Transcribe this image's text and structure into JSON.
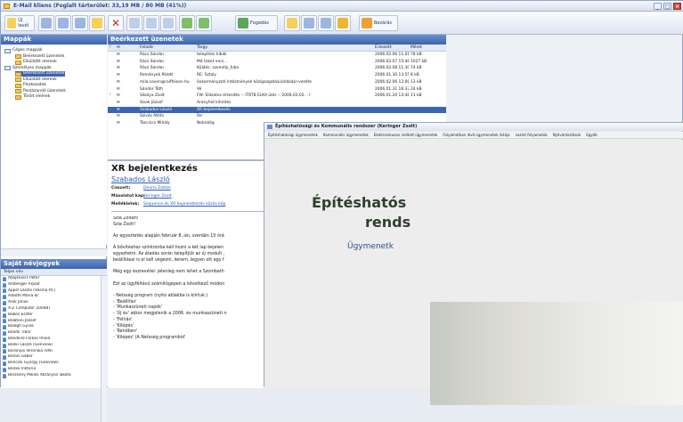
{
  "window": {
    "title": "E-Mail kliens (Foglalt tárterület: 33,19 MB / 80 MB (41%))"
  },
  "toolbar": {
    "new_label": "Új levél",
    "forward_label": "Fogadás",
    "close_label": "Bezárás"
  },
  "folders": {
    "title": "Mappák",
    "items": [
      {
        "label": "Céges mappák",
        "level": 0,
        "selected": false
      },
      {
        "label": "Beérkezett üzenetek",
        "level": 2,
        "selected": false
      },
      {
        "label": "Elküldött elemek",
        "level": 2,
        "selected": false
      },
      {
        "label": "Személyes mappák",
        "level": 0,
        "selected": false
      },
      {
        "label": "Beérkezett üzenetek",
        "level": 2,
        "selected": true
      },
      {
        "label": "Elküldött elemek",
        "level": 2,
        "selected": false
      },
      {
        "label": "Piszkozatok",
        "level": 2,
        "selected": false
      },
      {
        "label": "Postázandó üzenetek",
        "level": 2,
        "selected": false
      },
      {
        "label": "Törölt elemek",
        "level": 2,
        "selected": false
      }
    ]
  },
  "contacts": {
    "title": "Saját névjegyek",
    "column": "Teljes név",
    "items": [
      "Abajkovics Péter",
      "Amberger Árpád",
      "Appel László (Vasmű Rt.)",
      "Asbóth Mária dr.",
      "Árok János",
      "A-Z Computer 2000BT",
      "Babos Eszter",
      "Balatoni József",
      "Balogh Gyula",
      "Bándli Tibor",
      "Bándliné Farkas Imola",
      "Bánki László (Genview)",
      "Baranyai Veronika (VN)",
      "Barosi Gábor",
      "Benczik György (Geoview)",
      "Benke Viktória",
      "Berzsény Miklós Ábrányos lakota"
    ]
  },
  "maillist": {
    "title": "Beérkezett üzenetek",
    "columns": [
      "!",
      "✉",
      "Feladó",
      "Tárgy",
      "Érkezett",
      "Méret"
    ],
    "rows": [
      {
        "from": "Rácz Sándor",
        "subject": "telepítési hibák",
        "date": "2006.02.06 11:01",
        "size": "78 kB",
        "flag": "",
        "selected": false
      },
      {
        "from": "Rácz Sándor",
        "subject": "Mit teket enni...",
        "date": "2006.02.07 15:48",
        "size": "1027 kB",
        "flag": "",
        "selected": false
      },
      {
        "from": "Rácz Sándor",
        "subject": "Küldés: személy_hiba",
        "date": "2006.02.08 11:30",
        "size": "74 kB",
        "flag": "",
        "selected": false
      },
      {
        "from": "Remények Pólett",
        "subject": "RE: Sztaly",
        "date": "2006.01.30 13:55",
        "size": "8 kB",
        "flag": "",
        "selected": false
      },
      {
        "from": "mila.saven@raiffeisen.hu",
        "subject": "önkormányzati intézmények közigazgatási(oldalak)-vezéte",
        "date": "2006.02.06 12:08",
        "size": "13 kB",
        "flag": "",
        "selected": false
      },
      {
        "from": "Sándor Tóth",
        "subject": "Vé",
        "date": "2006.01.31 16:37",
        "size": "24 kB",
        "flag": "",
        "selected": false
      },
      {
        "from": "Sikolya Zsolt",
        "subject": "FW: Előzetes értesítés -- ITKTB ELKA ülés -- 2006.02.02. - I",
        "date": "2006.01.20 13:48",
        "size": "11 kB",
        "flag": "!",
        "selected": false
      },
      {
        "from": "Sisak József",
        "subject": "Aranyhíd kihírdés",
        "date": "",
        "size": "",
        "flag": "",
        "selected": false
      },
      {
        "from": "Szabados László",
        "subject": "XR bejelentkezés",
        "date": "",
        "size": "",
        "flag": "",
        "selected": true
      },
      {
        "from": "Szivós Attila",
        "subject": "Re:",
        "date": "",
        "size": "",
        "flag": "",
        "selected": false
      },
      {
        "from": "Táncsics Mihály",
        "subject": "Nekrológ",
        "date": "",
        "size": "",
        "flag": "",
        "selected": false
      }
    ]
  },
  "preview": {
    "subject": "XR bejelentkezés",
    "from": "Szabados László",
    "to_label": "Címzett:",
    "to": "Deorla Zoltán",
    "cc_label": "Másolatot kap:",
    "cc": "Keringer Zsolt",
    "att_label": "Mellékletek:",
    "att": "Sequence és XR bejelentkezés közös kép",
    "body": [
      "Szia Zoltán!",
      "Szia Zsolt!",
      "",
      "Az egyeztetés alapján február 8.-án, szerdán 10 órá",
      "",
      "A bővítéshez szinkronba kell hozni a két lap bejelen",
      "egyeztetni. Az átadás során telepítjük az új modult ,",
      "beállításai is el kell végezni, kérem, legyen ott egy f",
      "",
      "Még egy észrevétel: jelenleg nem lehet a Szombath",
      "",
      "Ezt az ügyféltávú számítógépen a következő módon",
      "",
      "- Netsség program (nyitó ablakba is kiírtuk:)",
      "- 'Beállítás'",
      "- 'Munkaszüneti napok'",
      "- 'Új év' akkor megjelenik a 2006. év munkaszüneti n",
      "- 'Felírás'",
      "- 'Kilépés'",
      "- 'Rendben'",
      "- 'Kilépés' (A Netsség programból'"
    ]
  },
  "win2": {
    "title": "Építéshatósági és Kommunális rendszer (Keringer Zsolt)",
    "menu": [
      "Építéshatósági ügymenetek",
      "Kommunális ügymenetek",
      "Elektronikusan indított ügymenetek",
      "Folyamatban lévő ügymenetek listája",
      "Lezárt folyamatok",
      "Nyilvántartások",
      "Egyéb"
    ],
    "splash_line1": "Építéshatós",
    "splash_line2": "rends",
    "splash_sub": "Ügymenetk"
  },
  "icons": {
    "folder": "folder-icon",
    "contact": "contact-icon",
    "mail": "mail-icon"
  },
  "colors": {
    "panel_header": "#3c64ab",
    "selection": "#3a65b1",
    "link": "#2c59b7"
  }
}
